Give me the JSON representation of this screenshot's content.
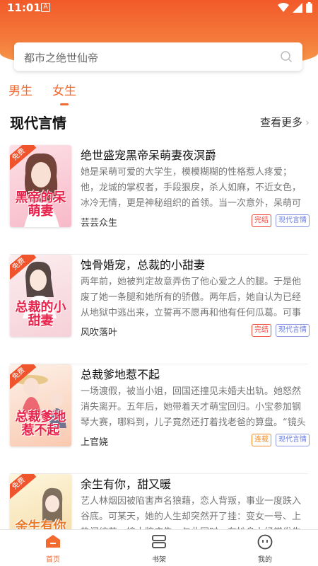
{
  "status_bar": {
    "time": "11:01",
    "notification_letter": "A"
  },
  "search": {
    "placeholder": "都市之绝世仙帝"
  },
  "gender_tabs": [
    {
      "label": "男生",
      "active": false
    },
    {
      "label": "女生",
      "active": true
    }
  ],
  "section": {
    "title": "现代言情",
    "more_label": "查看更多"
  },
  "books": [
    {
      "title": "绝世盛宠黑帝呆萌妻夜溟爵",
      "description": "她是呆萌可爱的大学生，模模糊糊的性格惹人疼爱；他，龙城的掌权者，手段狠戾，杀人如麻，不近女色，冰冷无情，更是神秘组织的首领。当一次意外，呆萌可爱的她救了他，",
      "author": "芸芸众生",
      "status": "完结",
      "category": "现代言情",
      "cover_text": "黑帝的呆萌妻",
      "free_badge": "免费",
      "cover_colors": [
        "#fde0e6",
        "#f7b9c8"
      ]
    },
    {
      "title": "蚀骨婚宠，总裁的小甜妻",
      "description": "两年前，她被判定故意弄伤了他心爱之人的腿。于是他废了她一条腿和她所有的骄傲。两年后，她自认为已经从地狱中逃出来，立誓再不愿再和他有任何瓜葛。可事实证明，地狱…",
      "author": "风吹落叶",
      "status": "完结",
      "category": "现代言情",
      "cover_text": "总裁的小甜妻",
      "free_badge": "免费",
      "cover_colors": [
        "#fbeef0",
        "#f6d0d8"
      ]
    },
    {
      "title": "总裁爹地惹不起",
      "description": "一场渡假，被当小姐，回国还撞见未婚夫出轨。她怒然消失离开。五年后，她带着天才萌宝回归。小宝参加钢琴大赛，哪料到，儿子竟然还打着找老爸的算盘。“镜头往这边，把…",
      "author": "上官娆",
      "status": "连载",
      "category": "现代言情",
      "cover_text": "总裁爹地惹不起",
      "free_badge": "免费",
      "cover_colors": [
        "#fdf1e8",
        "#f9c9b0"
      ]
    },
    {
      "title": "余生有你，甜又暖",
      "description": "艺人林烟因被陷害声名狼藉，恋人背叛，事业一度跌入谷底。可某天，她的人生却突然开了挂：变女一号、上热门综艺、接大牌广告。与此同时，有她身上经常发生一些匪夷",
      "author": "",
      "status": "",
      "category": "",
      "cover_text": "余生有你甜又暖",
      "free_badge": "免费",
      "cover_colors": [
        "#fdf6dc",
        "#f4d8a0"
      ]
    }
  ],
  "bottom_nav": [
    {
      "label": "首页",
      "icon": "home-icon",
      "active": true
    },
    {
      "label": "书架",
      "icon": "bookshelf-icon",
      "active": false
    },
    {
      "label": "我的",
      "icon": "profile-icon",
      "active": false
    }
  ],
  "colors": {
    "accent": "#f26a2f",
    "header_top": "#f25a2a",
    "header_bottom": "#f7a04e"
  }
}
